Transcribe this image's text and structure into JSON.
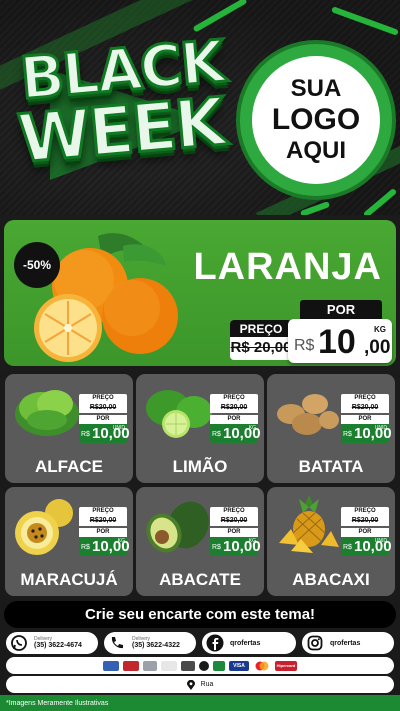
{
  "header": {
    "title_line1": "BLACK",
    "title_line2": "WEEK",
    "logo_line1": "SUA",
    "logo_line2": "LOGO",
    "logo_line3": "AQUI"
  },
  "featured": {
    "discount": "-50%",
    "name": "LARANJA",
    "por_label": "POR",
    "preco_label": "PREÇO",
    "old_price": "R$ 20,00",
    "currency": "R$",
    "price_int": "10",
    "price_dec": ",00",
    "unit": "KG",
    "image": "orange-icon"
  },
  "products": [
    {
      "name": "ALFACE",
      "preco_label": "PREÇO",
      "old_price": "R$20,00",
      "por_label": "POR",
      "currency": "R$",
      "price": "10,00",
      "unit": "UNID",
      "image": "lettuce-icon"
    },
    {
      "name": "LIMÃO",
      "preco_label": "PREÇO",
      "old_price": "R$20,00",
      "por_label": "POR",
      "currency": "R$",
      "price": "10,00",
      "unit": "KG",
      "image": "lime-icon"
    },
    {
      "name": "BATATA",
      "preco_label": "PREÇO",
      "old_price": "R$20,00",
      "por_label": "POR",
      "currency": "R$",
      "price": "10,00",
      "unit": "UNID",
      "image": "potato-icon"
    },
    {
      "name": "MARACUJÁ",
      "preco_label": "PREÇO",
      "old_price": "R$20,00",
      "por_label": "POR",
      "currency": "R$",
      "price": "10,00",
      "unit": "KG",
      "image": "passionfruit-icon"
    },
    {
      "name": "ABACATE",
      "preco_label": "PREÇO",
      "old_price": "R$20,00",
      "por_label": "POR",
      "currency": "R$",
      "price": "10,00",
      "unit": "KG",
      "image": "avocado-icon"
    },
    {
      "name": "ABACAXI",
      "preco_label": "PREÇO",
      "old_price": "R$20,00",
      "por_label": "POR",
      "currency": "R$",
      "price": "10,00",
      "unit": "UNID",
      "image": "pineapple-icon"
    }
  ],
  "cta": "Crie seu encarte com este tema!",
  "contacts": [
    {
      "icon": "whatsapp-icon",
      "caption": "Delivery",
      "value": "(35) 3622-4674"
    },
    {
      "icon": "phone-icon",
      "caption": "Delivery",
      "value": "(35) 3622-4322"
    },
    {
      "icon": "facebook-icon",
      "caption": "",
      "value": "qrofertas"
    },
    {
      "icon": "instagram-icon",
      "caption": "",
      "value": "qrofertas"
    }
  ],
  "payments": [
    {
      "name": "card-icon",
      "label": "",
      "color": "#3561b5"
    },
    {
      "name": "card-icon",
      "label": "",
      "color": "#c2272d"
    },
    {
      "name": "card-icon",
      "label": "",
      "color": "#9aa1a8"
    },
    {
      "name": "card-icon",
      "label": "",
      "color": "#e7e7e7"
    },
    {
      "name": "card-icon",
      "label": "",
      "color": "#4a4a4a"
    },
    {
      "name": "card-icon",
      "label": "",
      "color": "#1a1a1a"
    },
    {
      "name": "card-icon",
      "label": "",
      "color": "#1c8a3a"
    },
    {
      "name": "visa-icon",
      "label": "VISA",
      "color": "#1a3a8f"
    },
    {
      "name": "mastercard-icon",
      "label": "",
      "color": "#f08a24"
    },
    {
      "name": "hipercard-icon",
      "label": "Hipercard",
      "color": "#c8202e"
    }
  ],
  "address": {
    "icon": "location-pin-icon",
    "text": "Rua"
  },
  "disclaimer": "*Imagens Meramente Ilustrativas",
  "colors": {
    "brand_green": "#2ea93f",
    "dark_green": "#1c7f2f",
    "card_gray": "#5a5a5a"
  }
}
